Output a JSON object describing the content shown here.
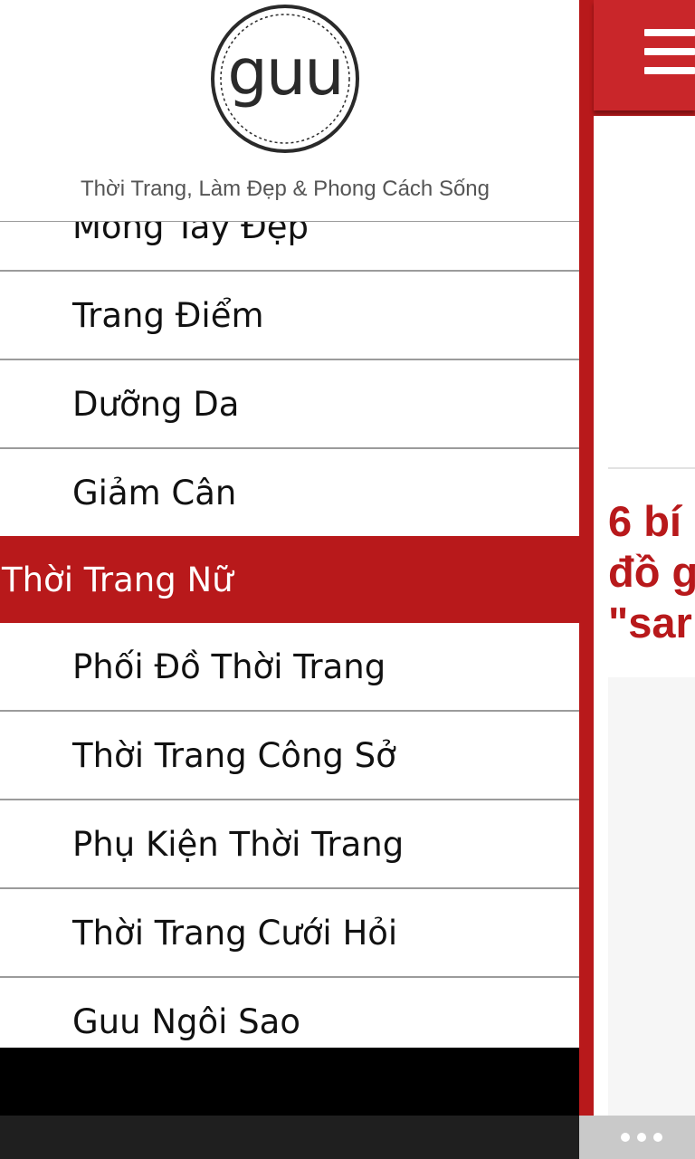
{
  "brand": {
    "logo_text": "guu",
    "tagline": "Thời Trang, Làm Đẹp & Phong Cách Sống"
  },
  "menu": {
    "items": [
      {
        "label": "Móng Tay Đẹp",
        "type": "sub"
      },
      {
        "label": "Trang Điểm",
        "type": "sub"
      },
      {
        "label": "Dưỡng Da",
        "type": "sub"
      },
      {
        "label": "Giảm Cân",
        "type": "sub"
      },
      {
        "label": "Thời Trang Nữ",
        "type": "category"
      },
      {
        "label": "Phối Đồ Thời Trang",
        "type": "sub"
      },
      {
        "label": "Thời Trang Công Sở",
        "type": "sub"
      },
      {
        "label": "Phụ Kiện Thời Trang",
        "type": "sub"
      },
      {
        "label": "Thời Trang Cưới Hỏi",
        "type": "sub"
      },
      {
        "label": "Guu Ngôi Sao",
        "type": "sub"
      }
    ]
  },
  "content": {
    "title_lines": [
      "6 bí",
      "đồ g",
      "\"sar"
    ]
  },
  "colors": {
    "accent": "#b8191b",
    "header_red": "#c9262a",
    "app_bar": "#1f1f1f"
  },
  "icons": {
    "menu": "hamburger-icon",
    "more": "ellipsis-icon"
  }
}
